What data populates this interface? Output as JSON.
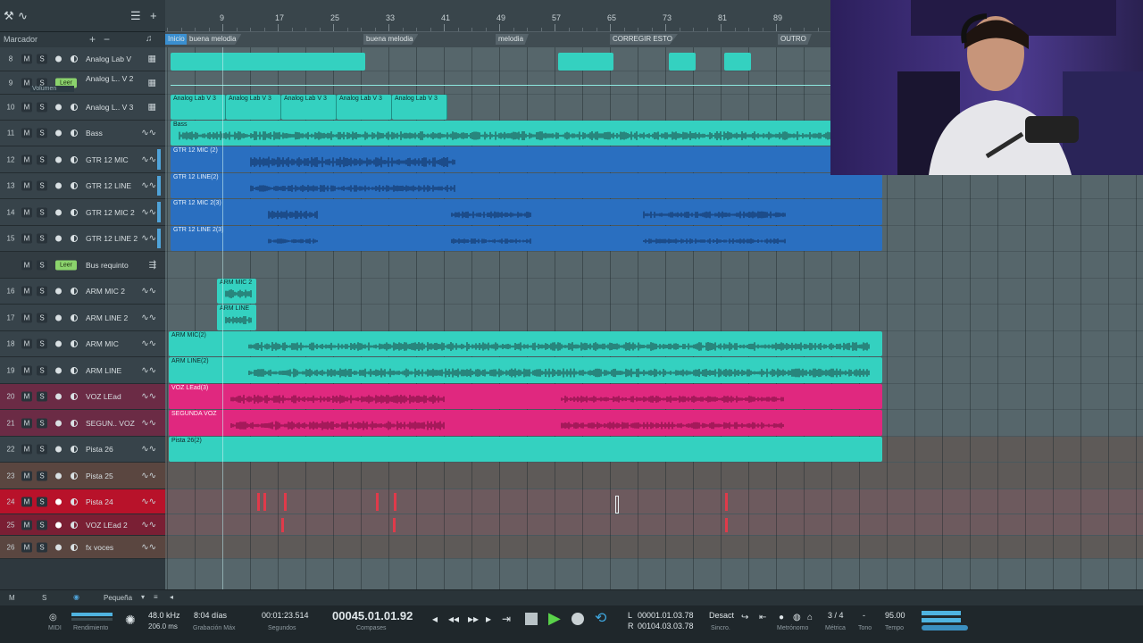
{
  "header": {
    "marker_label": "Marcador",
    "ruler_ticks": [
      "9",
      "17",
      "25",
      "33",
      "41",
      "49",
      "57",
      "65",
      "73",
      "81",
      "89"
    ]
  },
  "markers": [
    {
      "label": "Inicio"
    },
    {
      "label": "buena melodia"
    },
    {
      "label": "buena melodia"
    },
    {
      "label": "melodia"
    },
    {
      "label": "CORREGIR ESTO"
    },
    {
      "label": "OUTRO"
    }
  ],
  "tracks": [
    {
      "num": "8",
      "name": "Analog Lab V",
      "read": ""
    },
    {
      "num": "9",
      "name": "Analog L.. V 2",
      "read": "Leer",
      "sub": "Volumen"
    },
    {
      "num": "10",
      "name": "Analog L.. V 3",
      "read": ""
    },
    {
      "num": "11",
      "name": "Bass",
      "read": ""
    },
    {
      "num": "12",
      "name": "GTR 12 MIC",
      "read": ""
    },
    {
      "num": "13",
      "name": "GTR 12 LINE",
      "read": ""
    },
    {
      "num": "14",
      "name": "GTR 12 MIC  2",
      "read": ""
    },
    {
      "num": "15",
      "name": "GTR 12 LINE 2",
      "read": ""
    },
    {
      "num": "",
      "name": "Bus requinto",
      "read": "Leer"
    },
    {
      "num": "16",
      "name": "ARM MIC 2",
      "read": ""
    },
    {
      "num": "17",
      "name": "ARM LINE 2",
      "read": ""
    },
    {
      "num": "18",
      "name": "ARM MIC",
      "read": ""
    },
    {
      "num": "19",
      "name": "ARM LINE",
      "read": ""
    },
    {
      "num": "20",
      "name": "VOZ LEad",
      "read": ""
    },
    {
      "num": "21",
      "name": "SEGUN.. VOZ",
      "read": ""
    },
    {
      "num": "22",
      "name": "Pista 26",
      "read": ""
    },
    {
      "num": "23",
      "name": "Pista 25",
      "read": ""
    },
    {
      "num": "24",
      "name": "Pista 24",
      "read": ""
    },
    {
      "num": "25",
      "name": "VOZ LEad 2",
      "read": ""
    },
    {
      "num": "26",
      "name": "fx voces",
      "read": ""
    }
  ],
  "button_labels": {
    "mute": "M",
    "solo": "S"
  },
  "clip_labels": {
    "analog3": [
      "Analog Lab V 3",
      "Analog Lab V 3",
      "Analog Lab V 3",
      "Analog Lab V 3",
      "Analog Lab V 3"
    ],
    "bass": "Bass",
    "gtr_mic2": "GTR 12 MIC (2)",
    "gtr_line2": "GTR 12 LINE(2)",
    "gtr_mic23": "GTR 12 MIC  2(3)",
    "gtr_line23": "GTR 12 LINE 2(3)",
    "arm_mic_small": "ARM MIC 2",
    "arm_line_small": "ARM LINE",
    "arm_mic2": "ARM MIC(2)",
    "arm_line2": "ARM LINE(2)",
    "voz_lead3": "VOZ LEad(3)",
    "segunda_voz": "SEGUNDA VOZ",
    "pista26": "Pista 26(2)"
  },
  "status_strip": {
    "m": "M",
    "s": "S",
    "size": "Pequeña"
  },
  "transport": {
    "midi_label": "MIDI",
    "perf_label": "Rendimiento",
    "sample_rate": "48.0 kHz",
    "sample_rate_sub": "206.0 ms",
    "rec_time": "8:04 días",
    "rec_time_label": "Grabación Máx",
    "seconds": "00:01:23.514",
    "seconds_label": "Segundos",
    "bars": "00045.01.01.92",
    "bars_label": "Compases",
    "loop_l_label": "L",
    "loop_l": "00001.01.03.78",
    "loop_r_label": "R",
    "loop_r": "00104.03.03.78",
    "sync": "Desact",
    "sync_label": "Sincro.",
    "metronome_label": "Metrónomo",
    "time_sig": "3 / 4",
    "time_sig_label": "Métrica",
    "key": "-",
    "key_label": "Tono",
    "tempo": "95.00",
    "tempo_label": "Tempo"
  },
  "colors": {
    "teal": "#34d1c0",
    "blue": "#2a6fc0",
    "pink": "#e0287f",
    "record_red": "#c0162e",
    "read_green": "#8bd36c"
  }
}
